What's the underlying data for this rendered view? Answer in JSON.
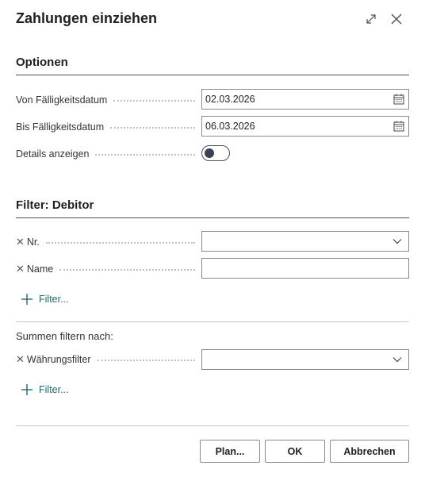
{
  "dialog": {
    "title": "Zahlungen einziehen"
  },
  "header_icons": {
    "expand": "expand-icon",
    "close": "close-icon"
  },
  "options": {
    "section_title": "Optionen",
    "from_due_date": {
      "label": "Von Fälligkeitsdatum",
      "value": "02.03.2026"
    },
    "to_due_date": {
      "label": "Bis Fälligkeitsdatum",
      "value": "06.03.2026"
    },
    "show_details": {
      "label": "Details anzeigen",
      "enabled": false
    }
  },
  "customer_filter": {
    "section_title": "Filter: Debitor",
    "fields": [
      {
        "label": "Nr.",
        "value": ""
      },
      {
        "label": "Name",
        "value": ""
      }
    ],
    "add_filter_label": "Filter..."
  },
  "totals_filter": {
    "heading": "Summen filtern nach:",
    "fields": [
      {
        "label": "Währungsfilter",
        "value": ""
      }
    ],
    "add_filter_label": "Filter..."
  },
  "footer": {
    "plan_label": "Plan...",
    "ok_label": "OK",
    "cancel_label": "Abbrechen"
  },
  "colors": {
    "accent": "#1f6b6b",
    "text": "#212121",
    "toggle_knob": "#3a4155"
  }
}
